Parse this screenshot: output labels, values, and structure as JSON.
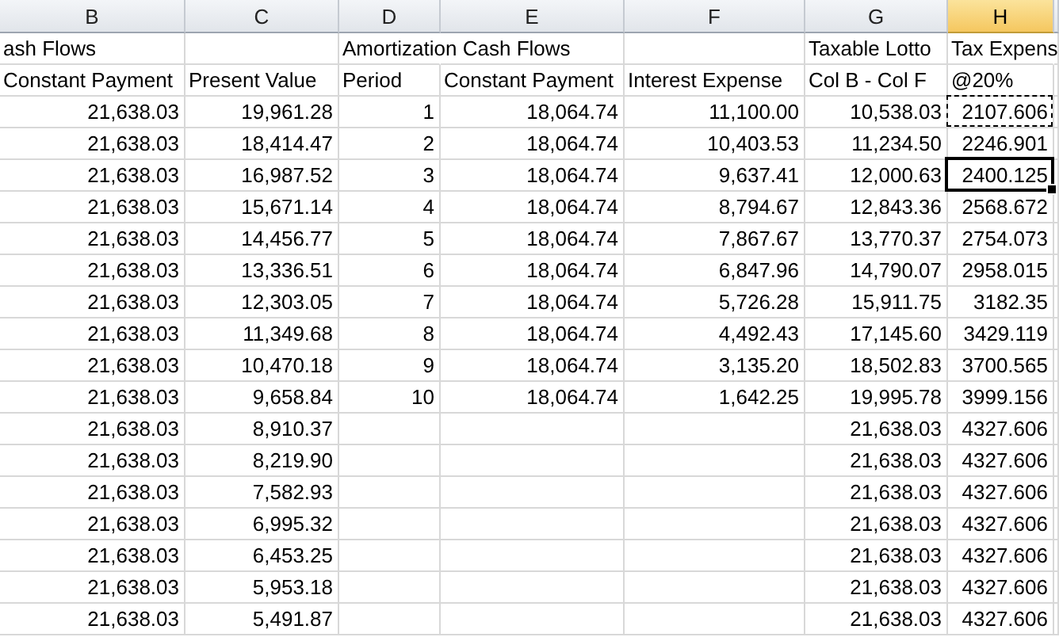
{
  "columns": [
    {
      "label": "B",
      "selected": false
    },
    {
      "label": "C",
      "selected": false
    },
    {
      "label": "D",
      "selected": false
    },
    {
      "label": "E",
      "selected": false
    },
    {
      "label": "F",
      "selected": false
    },
    {
      "label": "G",
      "selected": false
    },
    {
      "label": "H",
      "selected": true
    }
  ],
  "rows": [
    {
      "cells": [
        "ash Flows",
        null,
        "Amortization Cash Flows",
        null,
        null,
        "Taxable Lotto",
        {
          "text": "Tax Expens",
          "selected": false,
          "copied": false
        }
      ]
    },
    {
      "cells": [
        "Constant Payment",
        "Present Value",
        "Period",
        "Constant Payment",
        "Interest Expense",
        "Col B - Col F",
        {
          "text": "@20%",
          "selected": false,
          "copied": false
        }
      ]
    },
    {
      "cells": [
        "21,638.03",
        "19,961.28",
        "1",
        "18,064.74",
        "11,100.00",
        "10,538.03",
        {
          "text": "2107.606",
          "selected": false,
          "copied": true
        }
      ]
    },
    {
      "cells": [
        "21,638.03",
        "18,414.47",
        "2",
        "18,064.74",
        "10,403.53",
        "11,234.50",
        {
          "text": "2246.901",
          "selected": false,
          "copied": false
        }
      ]
    },
    {
      "cells": [
        "21,638.03",
        "16,987.52",
        "3",
        "18,064.74",
        "9,637.41",
        "12,000.63",
        {
          "text": "2400.125",
          "selected": true,
          "copied": false
        }
      ]
    },
    {
      "cells": [
        "21,638.03",
        "15,671.14",
        "4",
        "18,064.74",
        "8,794.67",
        "12,843.36",
        {
          "text": "2568.672",
          "selected": false,
          "copied": false
        }
      ]
    },
    {
      "cells": [
        "21,638.03",
        "14,456.77",
        "5",
        "18,064.74",
        "7,867.67",
        "13,770.37",
        {
          "text": "2754.073",
          "selected": false,
          "copied": false
        }
      ]
    },
    {
      "cells": [
        "21,638.03",
        "13,336.51",
        "6",
        "18,064.74",
        "6,847.96",
        "14,790.07",
        {
          "text": "2958.015",
          "selected": false,
          "copied": false
        }
      ]
    },
    {
      "cells": [
        "21,638.03",
        "12,303.05",
        "7",
        "18,064.74",
        "5,726.28",
        "15,911.75",
        {
          "text": "3182.35",
          "selected": false,
          "copied": false
        }
      ]
    },
    {
      "cells": [
        "21,638.03",
        "11,349.68",
        "8",
        "18,064.74",
        "4,492.43",
        "17,145.60",
        {
          "text": "3429.119",
          "selected": false,
          "copied": false
        }
      ]
    },
    {
      "cells": [
        "21,638.03",
        "10,470.18",
        "9",
        "18,064.74",
        "3,135.20",
        "18,502.83",
        {
          "text": "3700.565",
          "selected": false,
          "copied": false
        }
      ]
    },
    {
      "cells": [
        "21,638.03",
        "9,658.84",
        "10",
        "18,064.74",
        "1,642.25",
        "19,995.78",
        {
          "text": "3999.156",
          "selected": false,
          "copied": false
        }
      ]
    },
    {
      "cells": [
        "21,638.03",
        "8,910.37",
        null,
        null,
        null,
        "21,638.03",
        {
          "text": "4327.606",
          "selected": false,
          "copied": false
        }
      ]
    },
    {
      "cells": [
        "21,638.03",
        "8,219.90",
        null,
        null,
        null,
        "21,638.03",
        {
          "text": "4327.606",
          "selected": false,
          "copied": false
        }
      ]
    },
    {
      "cells": [
        "21,638.03",
        "7,582.93",
        null,
        null,
        null,
        "21,638.03",
        {
          "text": "4327.606",
          "selected": false,
          "copied": false
        }
      ]
    },
    {
      "cells": [
        "21,638.03",
        "6,995.32",
        null,
        null,
        null,
        "21,638.03",
        {
          "text": "4327.606",
          "selected": false,
          "copied": false
        }
      ]
    },
    {
      "cells": [
        "21,638.03",
        "6,453.25",
        null,
        null,
        null,
        "21,638.03",
        {
          "text": "4327.606",
          "selected": false,
          "copied": false
        }
      ]
    },
    {
      "cells": [
        "21,638.03",
        "5,953.18",
        null,
        null,
        null,
        "21,638.03",
        {
          "text": "4327.606",
          "selected": false,
          "copied": false
        }
      ]
    },
    {
      "cells": [
        "21,638.03",
        "5,491.87",
        null,
        null,
        null,
        "21,638.03",
        {
          "text": "4327.606",
          "selected": false,
          "copied": false
        }
      ]
    }
  ]
}
